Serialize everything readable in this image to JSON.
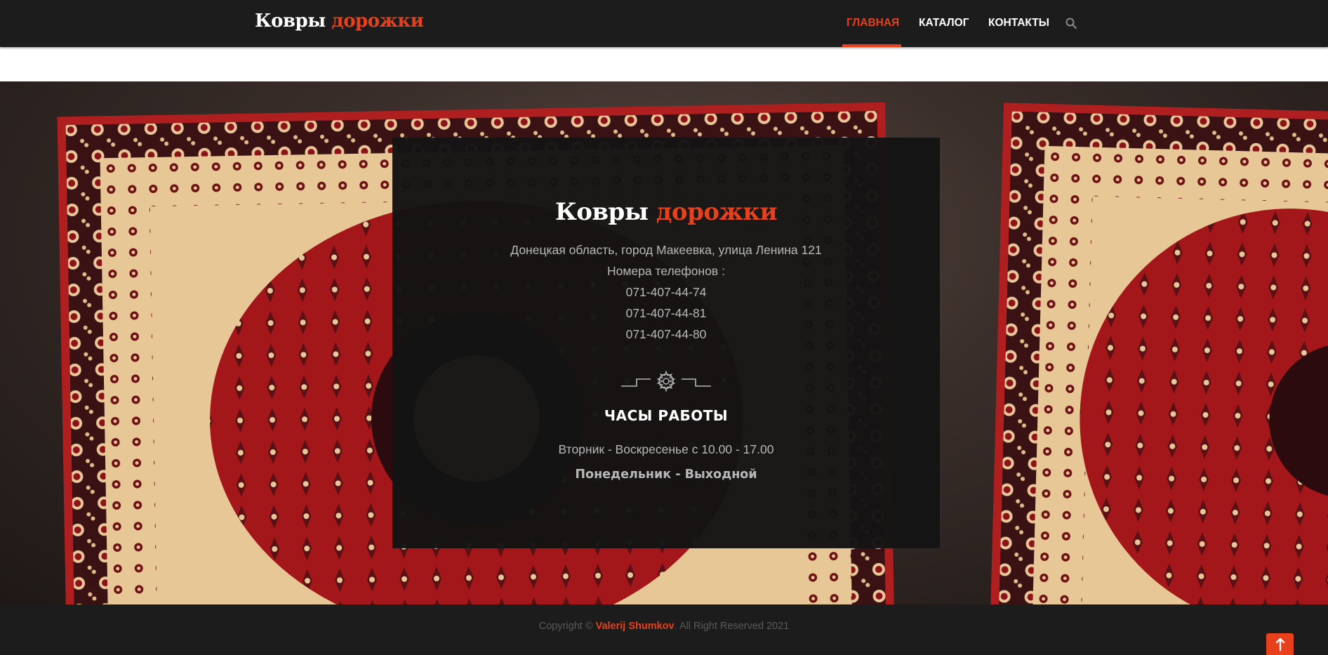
{
  "brand": {
    "word1": "Ковры",
    "word2": "дорожки"
  },
  "nav": {
    "items": [
      {
        "label": "ГЛАВНАЯ",
        "active": true
      },
      {
        "label": "КАТАЛОГ",
        "active": false
      },
      {
        "label": "КОНТАКТЫ",
        "active": false
      }
    ],
    "search_icon": "search-icon"
  },
  "info": {
    "address": "Донецкая область, город Макеевка, улица Ленина 121",
    "phones_label": "Номера телефонов :",
    "phones": [
      "071-407-44-74",
      "071-407-44-81",
      "071-407-44-80"
    ],
    "hours_title": "ЧАСЫ РАБОТЫ",
    "hours": "Вторник - Воскресенье с 10.00 - 17.00",
    "day_off": "Понедельник - Выходной"
  },
  "footer": {
    "copyright_prefix": "Copyright © ",
    "author": "Valerij Shumkov",
    "copyright_suffix": ". All Right Reserved 2021",
    "to_top_icon": "arrow-up-icon"
  },
  "colors": {
    "accent": "#e8401c",
    "header_bg": "#1c1c1c",
    "panel_bg": "#141414",
    "text_muted": "#b8b8b8"
  }
}
